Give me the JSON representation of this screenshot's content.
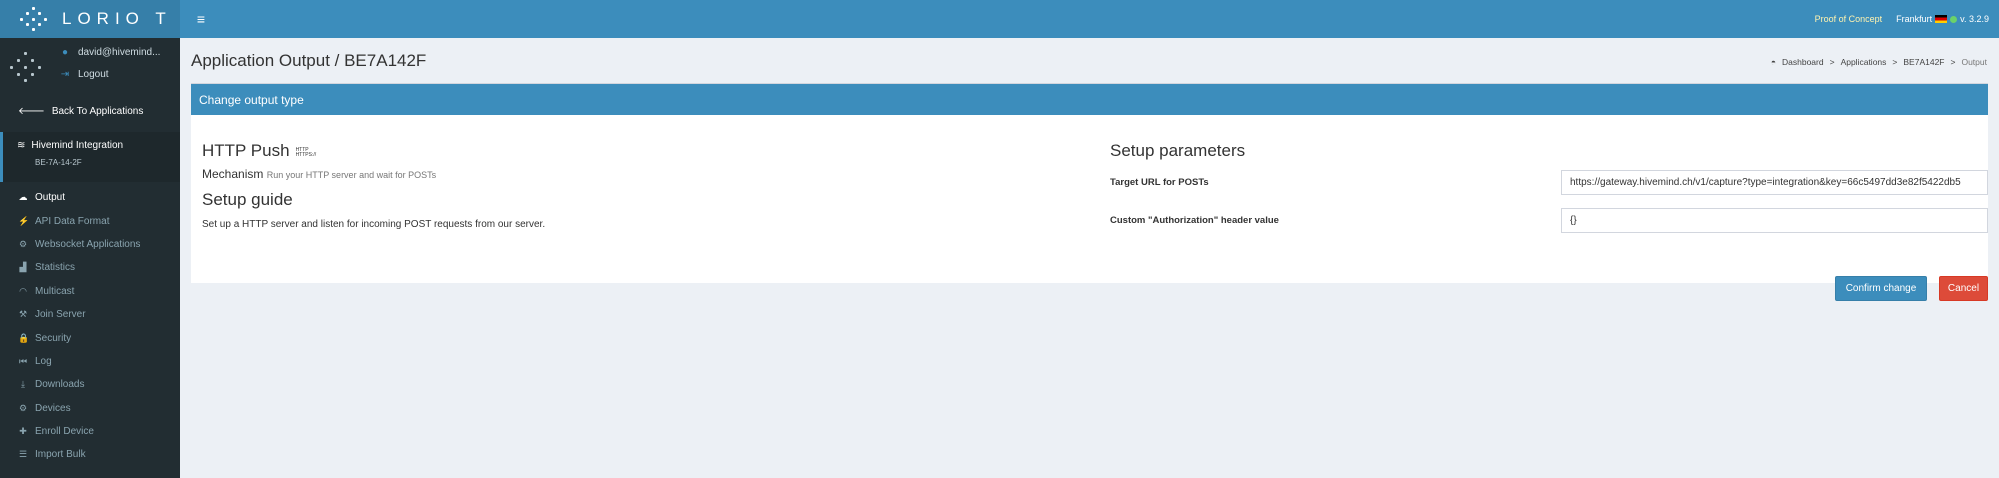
{
  "topbar": {
    "logo_text": "LORIO T",
    "menu_toggle_glyph": "≡",
    "proof_of_concept": "Proof of Concept",
    "region": "Frankfurt",
    "version": "v. 3.2.9"
  },
  "sidebar": {
    "user_email": "david@hivemind...",
    "logout": "Logout",
    "back_label": "Back To Applications",
    "app_name": "Hivemind Integration",
    "app_eui": "BE-7A-14-2F",
    "menu": [
      {
        "label": "Output",
        "icon": "cloud-upload-icon",
        "glyph": "☁"
      },
      {
        "label": "API Data Format",
        "icon": "plug-icon",
        "glyph": "⚡"
      },
      {
        "label": "Websocket Applications",
        "icon": "gear-icon",
        "glyph": "⚙"
      },
      {
        "label": "Statistics",
        "icon": "chart-icon",
        "glyph": "▟"
      },
      {
        "label": "Multicast",
        "icon": "rss-icon",
        "glyph": "◠"
      },
      {
        "label": "Join Server",
        "icon": "gavel-icon",
        "glyph": "⚒"
      },
      {
        "label": "Security",
        "icon": "lock-icon",
        "glyph": "🔒"
      },
      {
        "label": "Log",
        "icon": "log-icon",
        "glyph": "⏮"
      },
      {
        "label": "Downloads",
        "icon": "download-icon",
        "glyph": "⤓"
      },
      {
        "label": "Devices",
        "icon": "devices-icon",
        "glyph": "⚙"
      },
      {
        "label": "Enroll Device",
        "icon": "plus-icon",
        "glyph": "✚"
      },
      {
        "label": "Import Bulk",
        "icon": "list-icon",
        "glyph": "☰"
      }
    ]
  },
  "page": {
    "title": "Application Output / BE7A142F",
    "breadcrumb": [
      "Dashboard",
      "Applications",
      "BE7A142F",
      "Output"
    ]
  },
  "box": {
    "header": "Change output type",
    "left": {
      "heading": "HTTP Push",
      "mini_logo_top": "HTTP",
      "mini_logo_bottom": "HTTPS://",
      "mechanism_label": "Mechanism",
      "mechanism_desc": "Run your HTTP server and wait for POSTs",
      "guide_heading": "Setup guide",
      "guide_text": "Set up a HTTP server and listen for incoming POST requests from our server."
    },
    "right": {
      "heading": "Setup parameters",
      "target_label": "Target URL for POSTs",
      "target_value": "https://gateway.hivemind.ch/v1/capture?type=integration&key=66c5497dd3e82f5422db5",
      "auth_label": "Custom \"Authorization\" header value",
      "auth_value": "{}",
      "confirm_label": "Confirm change",
      "cancel_label": "Cancel"
    }
  },
  "colors": {
    "topbar": "#3c8dbc",
    "sidebar": "#222d32",
    "danger": "#dd4b39"
  }
}
